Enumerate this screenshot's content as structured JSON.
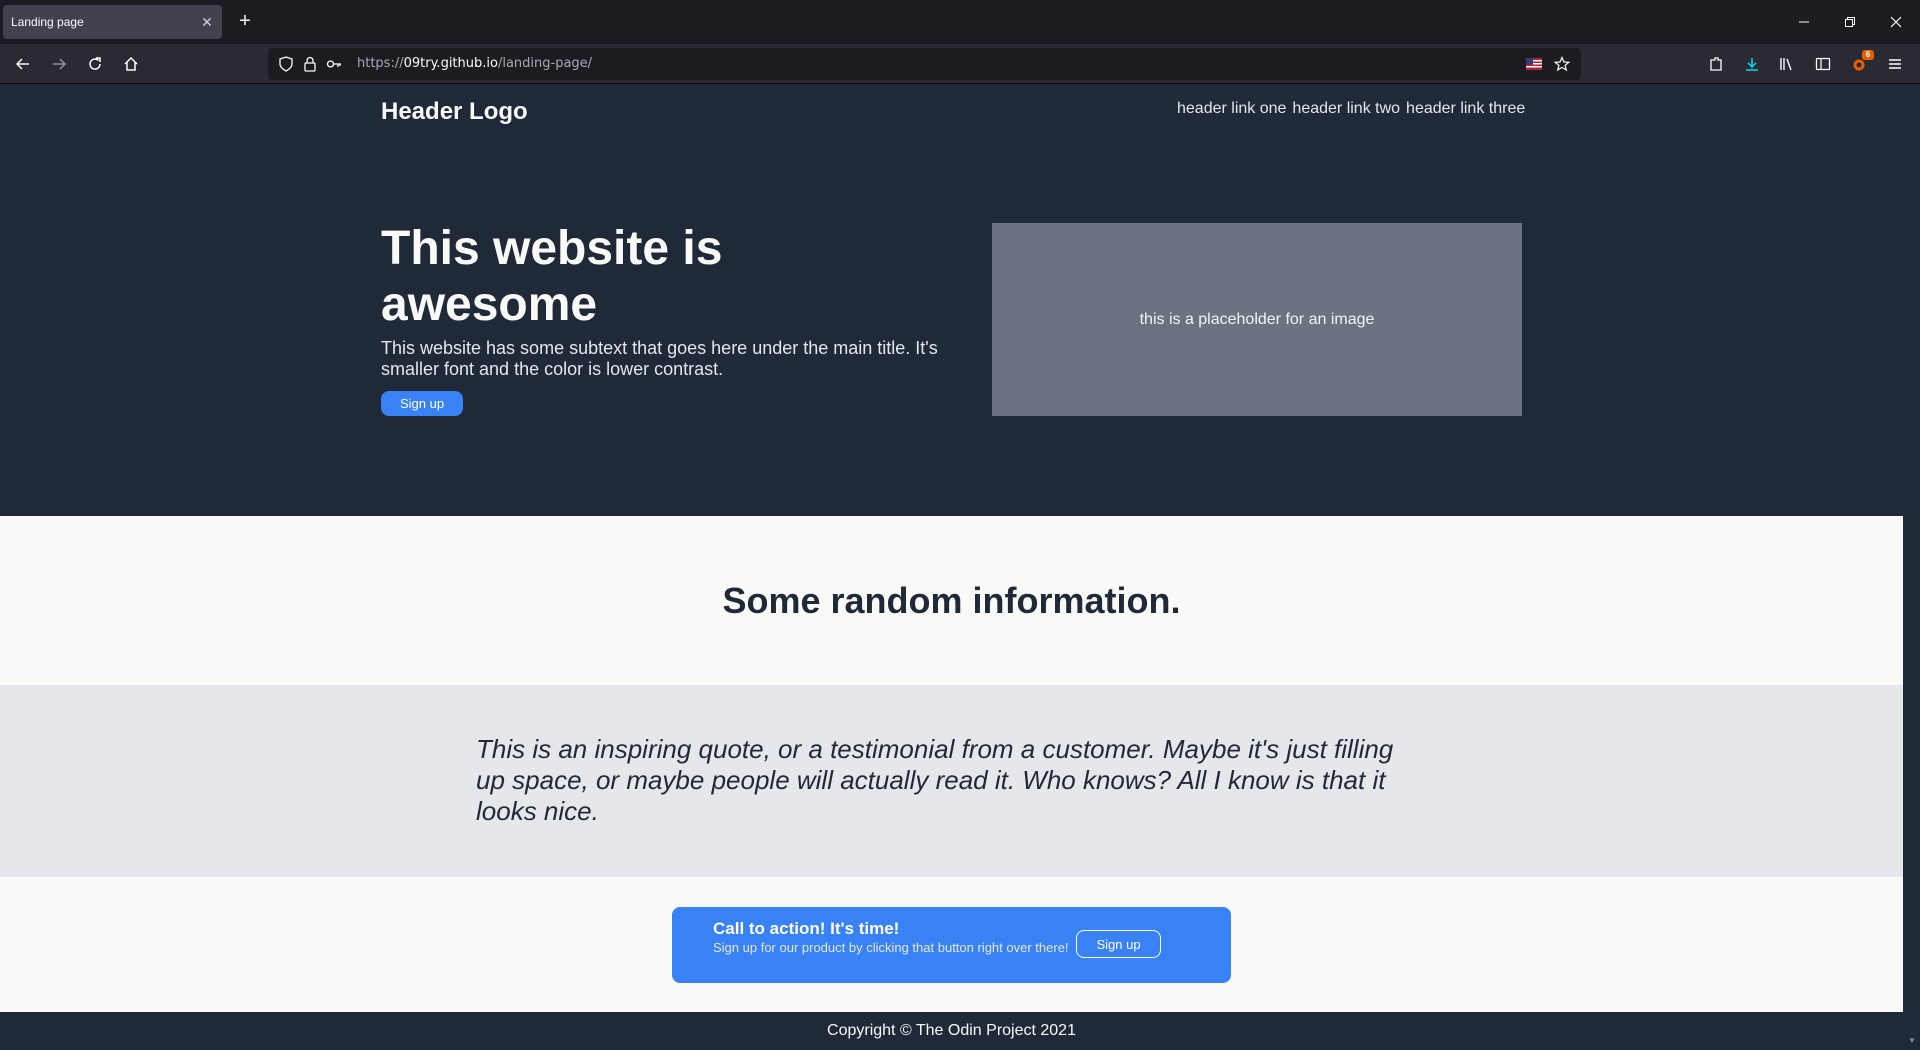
{
  "browser": {
    "tab_title": "Landing page",
    "tab_close": "✕",
    "new_tab": "+",
    "url_scheme": "https://",
    "url_host": "09try.github.io",
    "url_path": "/landing-page/",
    "extensions_badge": "6"
  },
  "header": {
    "logo": "Header Logo",
    "links": [
      "header link one",
      "header link two",
      "header link three"
    ]
  },
  "hero": {
    "title": "This website is awesome",
    "subtext": "This website has some subtext that goes here under the main title. It's smaller font and the color is lower contrast.",
    "button": "Sign up",
    "image_placeholder": "this is a placeholder for an image"
  },
  "info": {
    "title": "Some random information."
  },
  "quote": {
    "text": "This is an inspiring quote, or a testimonial from a customer. Maybe it's just filling up space, or maybe people will actually read it. Who knows? All I know is that it looks nice."
  },
  "cta": {
    "title": "Call to action! It's time!",
    "text": "Sign up for our product by clicking that button right over there!",
    "button": "Sign up"
  },
  "footer": {
    "text": "Copyright © The Odin Project 2021"
  },
  "colors": {
    "dark": "#1f2937",
    "light": "#f9faf8",
    "accent": "#3882f6",
    "quote_bg": "#e5e7eb",
    "placeholder": "#6b7280"
  }
}
